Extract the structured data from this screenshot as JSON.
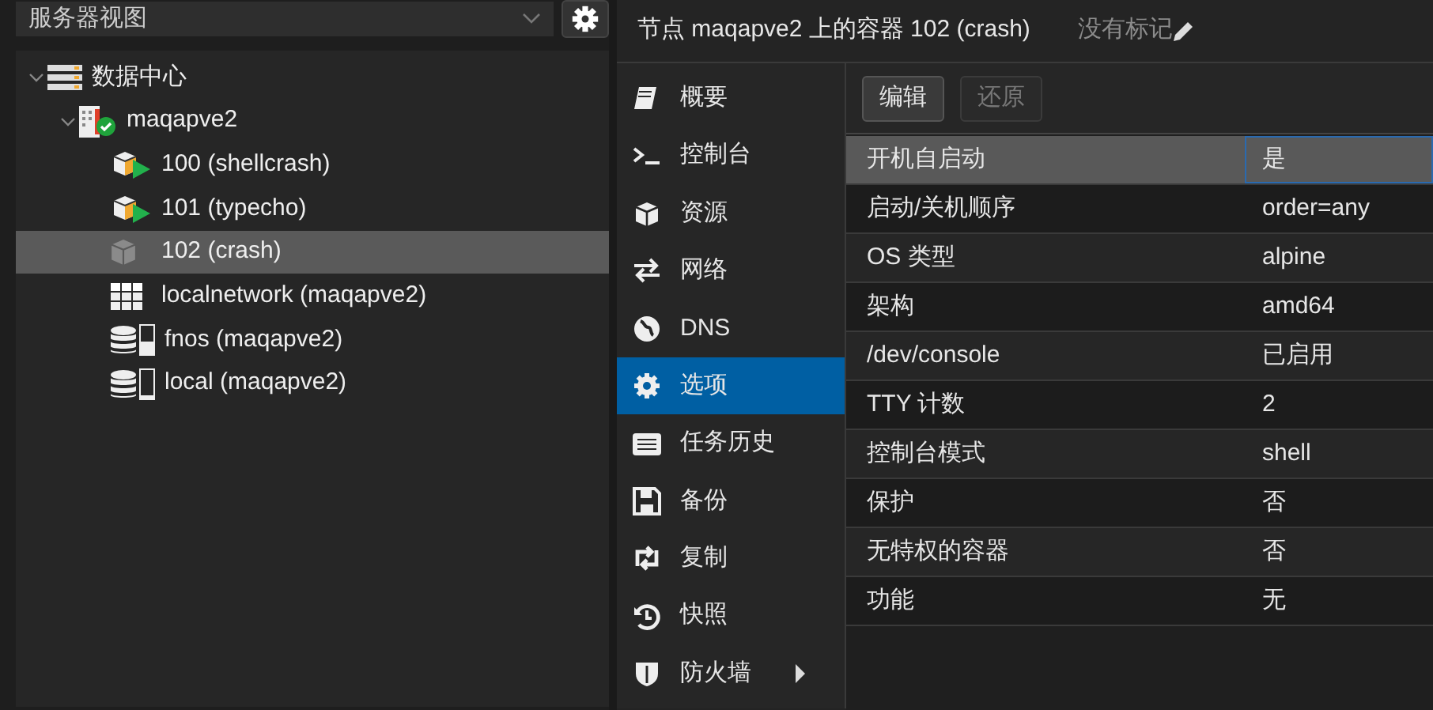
{
  "view_selector": {
    "value": "服务器视图"
  },
  "tree": [
    {
      "label": "数据中心",
      "kind": "datacenter",
      "expanded": true,
      "selected": false,
      "children": [
        {
          "label": "maqapve2",
          "kind": "node",
          "expanded": true,
          "selected": false,
          "children": [
            {
              "label": "100 (shellcrash)",
              "kind": "container_running",
              "selected": false
            },
            {
              "label": "101 (typecho)",
              "kind": "container_running",
              "selected": false
            },
            {
              "label": "102 (crash)",
              "kind": "container_stopped",
              "selected": true
            },
            {
              "label": "localnetwork (maqapve2)",
              "kind": "network",
              "selected": false
            },
            {
              "label": "fnos (maqapve2)",
              "kind": "storage",
              "level": 0.45,
              "selected": false
            },
            {
              "label": "local (maqapve2)",
              "kind": "storage",
              "level": 0.08,
              "selected": false
            }
          ]
        }
      ]
    }
  ],
  "header": {
    "title": "节点 maqapve2 上的容器 102 (crash)",
    "tags": "没有标记"
  },
  "nav": [
    {
      "label": "概要",
      "kind": "book",
      "selected": false,
      "submenu": false
    },
    {
      "label": "控制台",
      "kind": "terminal",
      "selected": false,
      "submenu": false
    },
    {
      "label": "资源",
      "kind": "cube",
      "selected": false,
      "submenu": false
    },
    {
      "label": "网络",
      "kind": "exchange",
      "selected": false,
      "submenu": false
    },
    {
      "label": "DNS",
      "kind": "globe",
      "selected": false,
      "submenu": false
    },
    {
      "label": "选项",
      "kind": "gear",
      "selected": true,
      "submenu": false
    },
    {
      "label": "任务历史",
      "kind": "list",
      "selected": false,
      "submenu": false
    },
    {
      "label": "备份",
      "kind": "floppy",
      "selected": false,
      "submenu": false
    },
    {
      "label": "复制",
      "kind": "retweet",
      "selected": false,
      "submenu": false
    },
    {
      "label": "快照",
      "kind": "history",
      "selected": false,
      "submenu": false
    },
    {
      "label": "防火墙",
      "kind": "shield",
      "selected": false,
      "submenu": true
    }
  ],
  "toolbar": [
    {
      "label": "编辑",
      "disabled": false
    },
    {
      "label": "还原",
      "disabled": true
    }
  ],
  "options": [
    {
      "name": "开机自启动",
      "value": "是",
      "selected": true
    },
    {
      "name": "启动/关机顺序",
      "value": "order=any",
      "selected": false
    },
    {
      "name": "OS 类型",
      "value": "alpine",
      "selected": false
    },
    {
      "name": "架构",
      "value": "amd64",
      "selected": false
    },
    {
      "name": "/dev/console",
      "value": "已启用",
      "selected": false
    },
    {
      "name": "TTY 计数",
      "value": "2",
      "selected": false
    },
    {
      "name": "控制台模式",
      "value": "shell",
      "selected": false
    },
    {
      "name": "保护",
      "value": "否",
      "selected": false
    },
    {
      "name": "无特权的容器",
      "value": "否",
      "selected": false
    },
    {
      "name": "功能",
      "value": "无",
      "selected": false
    }
  ]
}
